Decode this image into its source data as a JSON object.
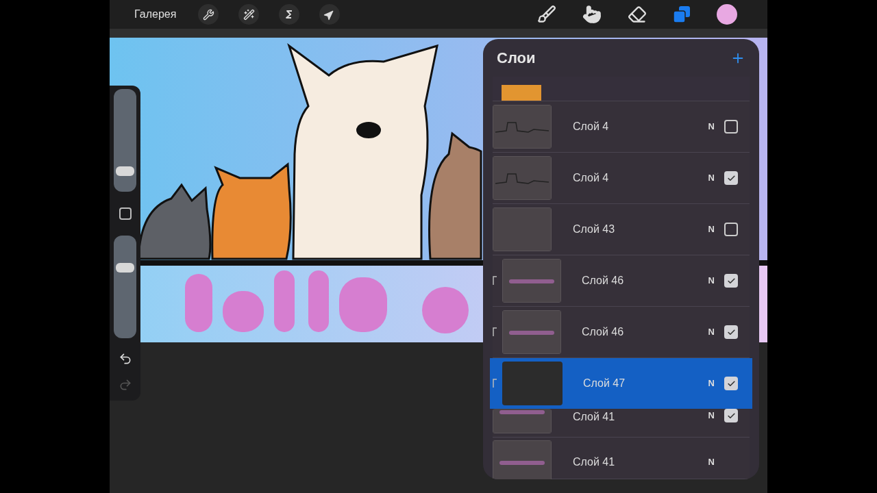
{
  "toolbar": {
    "gallery": "Галерея"
  },
  "sidebar": {
    "brush_size": {
      "level": 0.2
    },
    "opacity": {
      "level": 0.69
    },
    "undo": {
      "disabled": false
    },
    "redo": {
      "disabled": true
    }
  },
  "layers_panel": {
    "title": "Слои",
    "layers": [
      {
        "name": "Слой 4",
        "blend": "N",
        "kind": "normal",
        "checked": false,
        "selected": false
      },
      {
        "name": "Слой 4",
        "blend": "N",
        "kind": "normal",
        "checked": true,
        "selected": false
      },
      {
        "name": "Слой 43",
        "blend": "N",
        "kind": "normal",
        "checked": false,
        "selected": false
      },
      {
        "name": "Слой 46",
        "blend": "N",
        "kind": "clipped",
        "checked": true,
        "selected": false
      },
      {
        "name": "Слой 46",
        "blend": "N",
        "kind": "clipped",
        "checked": true,
        "selected": false
      },
      {
        "name": "Слой 47",
        "blend": "N",
        "kind": "clipped",
        "checked": true,
        "selected": true
      },
      {
        "name": "Слой 41",
        "blend": "N",
        "kind": "normal",
        "checked": true,
        "selected": false
      },
      {
        "name": "Слой 41",
        "blend": "N",
        "kind": "normal",
        "selected": false
      }
    ]
  }
}
